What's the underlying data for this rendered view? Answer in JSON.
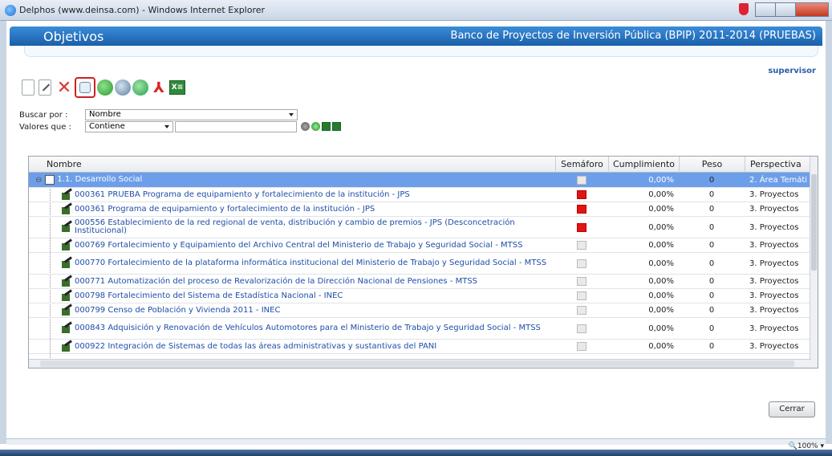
{
  "window": {
    "title": "Delphos (www.deinsa.com) - Windows Internet Explorer"
  },
  "header": {
    "left_title": "Objetivos",
    "right_title": "Banco de Proyectos de Inversión Pública (BPIP) 2011-2014 (PRUEBAS)"
  },
  "user": "supervisor",
  "toolbar": {
    "icons": [
      "new-icon",
      "edit-icon",
      "delete-icon",
      "search-icon",
      "refresh-icon",
      "zoom-icon",
      "back-icon",
      "pdf-icon",
      "excel-icon"
    ]
  },
  "search": {
    "buscar_label": "Buscar por :",
    "buscar_value": "Nombre",
    "valores_label": "Valores que :",
    "valores_value": "Contiene",
    "text_value": ""
  },
  "grid": {
    "columns": [
      "Nombre",
      "Semáforo",
      "Cumplimiento",
      "Peso",
      "Perspectiva"
    ],
    "rows": [
      {
        "name": "1.1. Desarrollo Social",
        "semaforo": "gray",
        "cumplimiento": "0,00%",
        "peso": "0",
        "perspectiva": "2. Área Temáti",
        "selected": true
      },
      {
        "name": "000361 PRUEBA Programa de equipamiento y fortalecimiento de la institución - JPS",
        "semaforo": "red",
        "cumplimiento": "0,00%",
        "peso": "0",
        "perspectiva": "3. Proyectos"
      },
      {
        "name": "000361 Programa de equipamiento y fortalecimiento de la institución - JPS",
        "semaforo": "red",
        "cumplimiento": "0,00%",
        "peso": "0",
        "perspectiva": "3. Proyectos"
      },
      {
        "name": "000556 Establecimiento de la red regional de venta, distribución y cambio de premios - JPS (Desconcetración Institucional)",
        "semaforo": "red",
        "cumplimiento": "0,00%",
        "peso": "0",
        "perspectiva": "3. Proyectos"
      },
      {
        "name": "000769 Fortalecimiento y Equipamiento del Archivo Central del Ministerio de Trabajo y Seguridad Social - MTSS",
        "semaforo": "gray",
        "cumplimiento": "0,00%",
        "peso": "0",
        "perspectiva": "3. Proyectos"
      },
      {
        "name": "000770 Fortalecimiento de la plataforma informática institucional del Ministerio de Trabajo y Seguridad Social - MTSS",
        "semaforo": "gray",
        "cumplimiento": "0,00%",
        "peso": "0",
        "perspectiva": "3. Proyectos"
      },
      {
        "name": "000771 Automatización del proceso de Revalorización de la Dirección Nacional de Pensiones - MTSS",
        "semaforo": "gray",
        "cumplimiento": "0,00%",
        "peso": "0",
        "perspectiva": "3. Proyectos"
      },
      {
        "name": "000798 Fortalecimiento del Sistema de Estadística Nacional - INEC",
        "semaforo": "gray",
        "cumplimiento": "0,00%",
        "peso": "0",
        "perspectiva": "3. Proyectos"
      },
      {
        "name": "000799 Censo de Población y Vivienda 2011 - INEC",
        "semaforo": "gray",
        "cumplimiento": "0,00%",
        "peso": "0",
        "perspectiva": "3. Proyectos"
      },
      {
        "name": "000843 Adquisición y Renovación de Vehículos Automotores para el Ministerio de Trabajo y Seguridad Social - MTSS",
        "semaforo": "gray",
        "cumplimiento": "0,00%",
        "peso": "0",
        "perspectiva": "3. Proyectos"
      },
      {
        "name": "000922 Integración de Sistemas de todas las áreas administrativas y sustantivas del PANI",
        "semaforo": "gray",
        "cumplimiento": "0,00%",
        "peso": "0",
        "perspectiva": "3. Proyectos"
      }
    ]
  },
  "buttons": {
    "cerrar": "Cerrar"
  },
  "status": {
    "zoom": "100%"
  },
  "colors": {
    "header": "#1a5fa8",
    "selected_row": "#6d9ee9",
    "red_status": "#e01515",
    "link_text": "#1f4ea8"
  }
}
